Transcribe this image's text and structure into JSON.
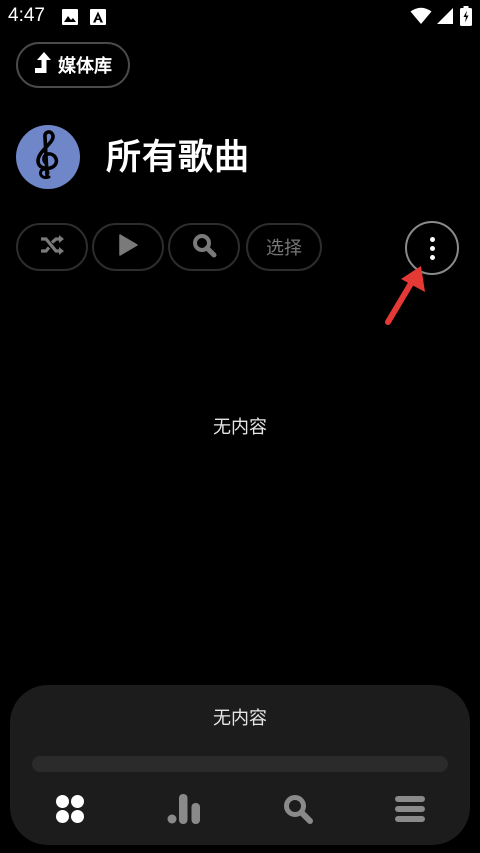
{
  "status_bar": {
    "time": "4:47",
    "icons": [
      "image-icon",
      "font-icon",
      "wifi-icon",
      "signal-icon",
      "battery-icon"
    ]
  },
  "library_button": {
    "label": "媒体库",
    "icon": "arrow-up-icon"
  },
  "header": {
    "title": "所有歌曲",
    "avatar_icon": "treble-clef-icon",
    "avatar_color": "#6f86c9"
  },
  "actions": [
    {
      "name": "shuffle",
      "icon": "shuffle-icon"
    },
    {
      "name": "play",
      "icon": "play-icon"
    },
    {
      "name": "search",
      "icon": "search-icon"
    },
    {
      "name": "select",
      "label": "选择"
    }
  ],
  "more_button": {
    "icon": "more-vertical-icon"
  },
  "annotation": {
    "color": "#e53935"
  },
  "empty_state": {
    "text": "无内容"
  },
  "player": {
    "title": "无内容",
    "progress": 0
  },
  "bottom_nav": [
    {
      "name": "library",
      "icon": "grid-icon"
    },
    {
      "name": "stats",
      "icon": "bar-chart-icon"
    },
    {
      "name": "search",
      "icon": "search-icon"
    },
    {
      "name": "menu",
      "icon": "menu-icon"
    }
  ]
}
